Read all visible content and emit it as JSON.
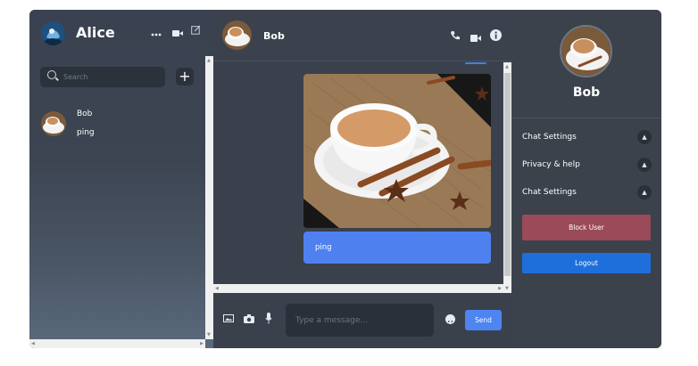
{
  "current_user": {
    "name": "Alice"
  },
  "left_header": {
    "icons": [
      "more-icon",
      "video-icon",
      "compose-icon"
    ]
  },
  "search": {
    "placeholder": "Search",
    "value": ""
  },
  "add_button": {
    "label": "+"
  },
  "contacts": [
    {
      "name": "Bob",
      "last_message": "ping"
    }
  ],
  "chat_header": {
    "name": "Bob",
    "icons": [
      "phone-icon",
      "video-icon",
      "info-icon"
    ]
  },
  "messages": [
    {
      "type": "image",
      "icon": "tea-cup-photo"
    },
    {
      "type": "text",
      "text": "ping"
    }
  ],
  "composer": {
    "icons": [
      "image-icon",
      "camera-icon",
      "mic-icon",
      "emoji-icon"
    ],
    "placeholder": "Type a message...",
    "value": "",
    "send_label": "Send"
  },
  "profile": {
    "name": "Bob",
    "sections": [
      {
        "label": "Chat Settings"
      },
      {
        "label": "Privacy & help"
      },
      {
        "label": "Chat Settings"
      }
    ],
    "block_label": "Block User",
    "logout_label": "Logout"
  },
  "colors": {
    "accent": "#4e85f0",
    "logout": "#1e6fdc",
    "block": "#9a4a58",
    "panel": "#3a414c"
  }
}
